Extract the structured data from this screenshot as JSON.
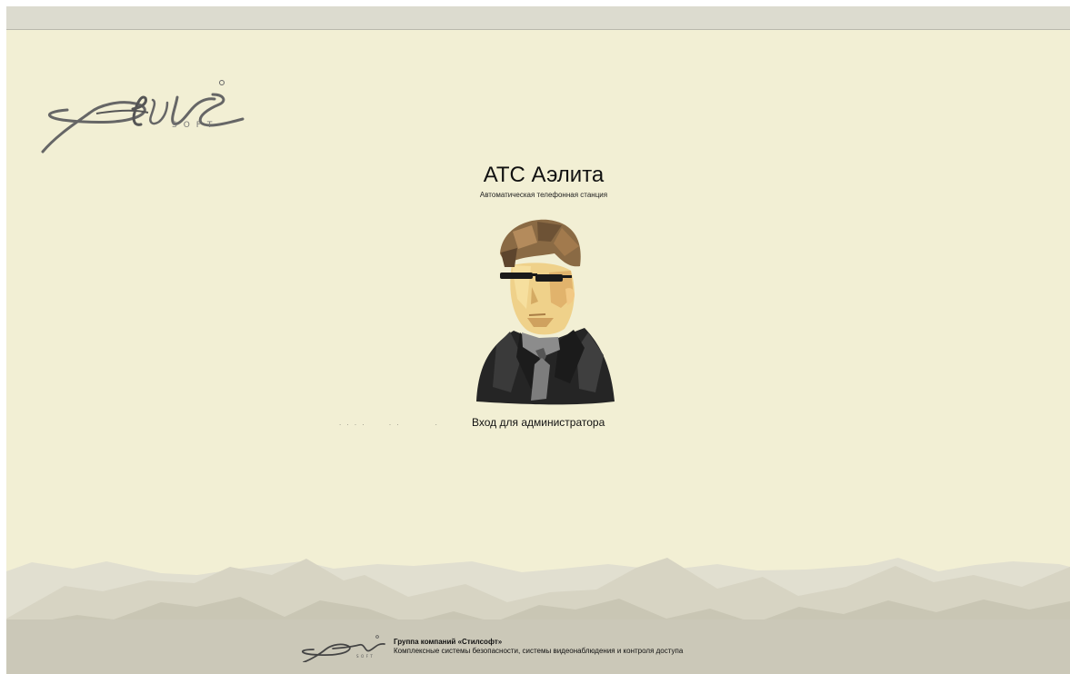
{
  "header": {
    "title": "АТС Аэлита",
    "subtitle": "Автоматическая телефонная станция"
  },
  "login": {
    "admin_label": "Вход для администратора",
    "dots": ". . . .      . .         ."
  },
  "footer": {
    "company": "Группа компаний «Стилсофт»",
    "description": "Комплексные системы безопасности, системы видеонаблюдения и контроля доступа"
  },
  "icons": {
    "logo": "stilsoft-logo-icon",
    "avatar": "admin-avatar-icon",
    "footer_logo": "stilsoft-footer-logo-icon"
  },
  "colors": {
    "page_background": "#f2efd4",
    "top_bar": "#dcdbcf",
    "mountain_fill": "#d8d5c5",
    "logo_stroke": "#666666"
  }
}
